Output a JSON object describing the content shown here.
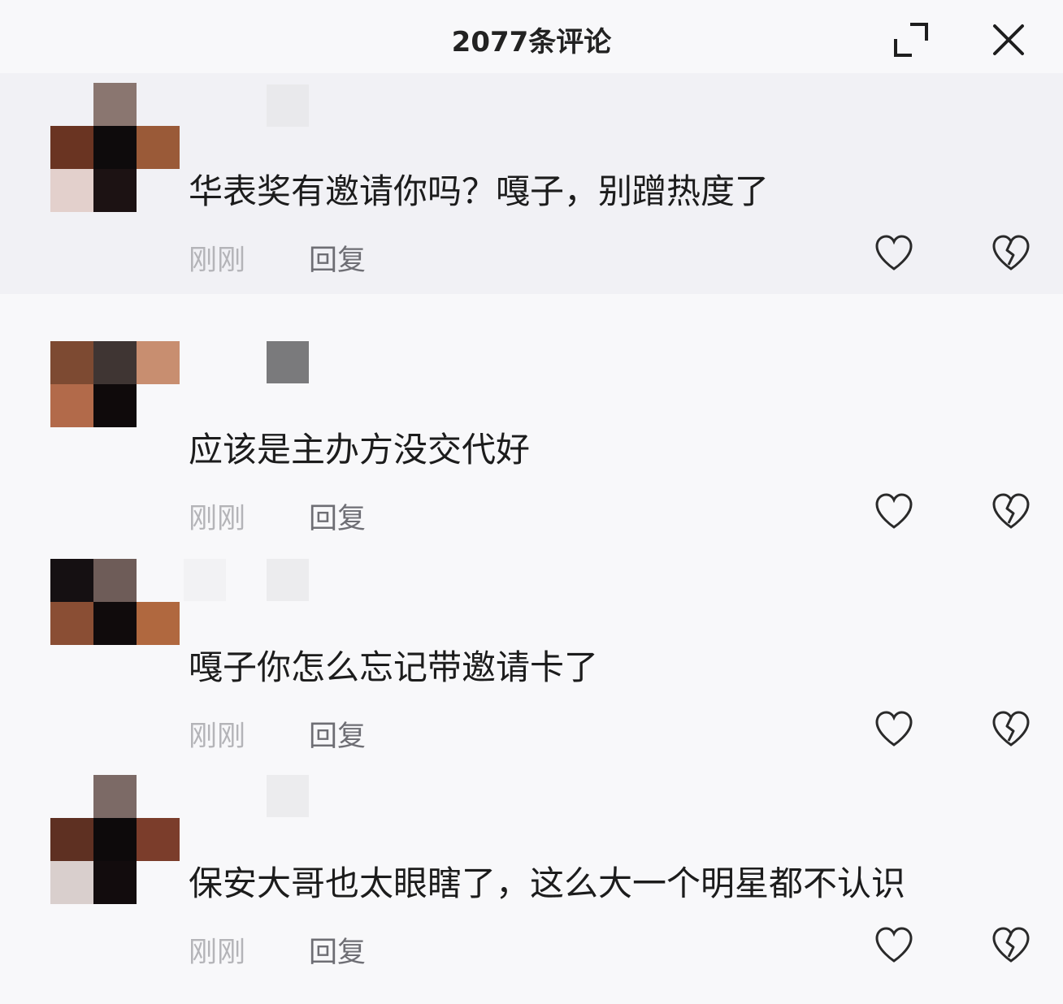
{
  "header": {
    "title": "2077条评论",
    "expand_icon": "expand-icon",
    "close_icon": "close-icon"
  },
  "comments": [
    {
      "text": "华表奖有邀请你吗？嘎子，别蹭热度了",
      "time": "刚刚",
      "reply_label": "回复",
      "avatar_colors": [
        "#f1f1f5",
        "#8a7670",
        "#f1f1f5",
        "#6a3422",
        "#0e0b0c",
        "#9a5a38",
        "#e3d0cc",
        "#1c1213",
        "#f1f1f5"
      ],
      "name_colors": [
        "#f1f1f5",
        "#e9e9ec"
      ]
    },
    {
      "text": "应该是主办方没交代好",
      "time": "刚刚",
      "reply_label": "回复",
      "avatar_colors": [
        "#7d4a32",
        "#3f3533",
        "#c88e70",
        "#b26a4a",
        "#0f0a0b",
        "#f8f8fa",
        "#f8f8fa",
        "#f8f8fa",
        "#f8f8fa"
      ],
      "name_colors": [
        "#f8f8fa",
        "#7a7a7c"
      ]
    },
    {
      "text": "嘎子你怎么忘记带邀请卡了",
      "time": "刚刚",
      "reply_label": "回复",
      "avatar_colors": [
        "#151012",
        "#6e5c58",
        "#f8f8fa",
        "#8a4e34",
        "#100b0c",
        "#b0683f",
        "#f8f8fa",
        "#f8f8fa",
        "#f8f8fa"
      ],
      "name_colors": [
        "#f2f2f4",
        "#ececee"
      ]
    },
    {
      "text": "保安大哥也太眼瞎了，这么大一个明星都不认识",
      "time": "刚刚",
      "reply_label": "回复",
      "avatar_colors": [
        "#f8f8fa",
        "#7c6a66",
        "#f8f8fa",
        "#5e3022",
        "#0d0a0b",
        "#7b3d2b",
        "#d9cfcd",
        "#120c0d",
        "#f8f8fa"
      ],
      "name_colors": [
        "#f8f8fa",
        "#ececee"
      ]
    }
  ],
  "icons": {
    "like": "heart-icon",
    "dislike": "broken-heart-icon"
  }
}
